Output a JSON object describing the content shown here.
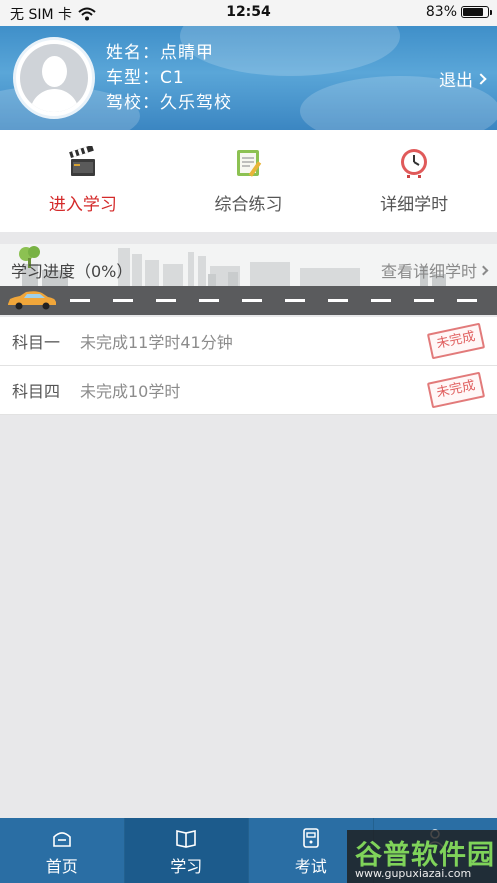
{
  "status_bar": {
    "carrier": "无 SIM 卡",
    "time": "12:54",
    "battery": "83%",
    "battery_level": 0.83
  },
  "header": {
    "name_label": "姓名：",
    "name_value": "点睛甲",
    "car_label": "车型：",
    "car_value": "C1",
    "school_label": "驾校：",
    "school_value": "久乐驾校",
    "logout": "退出"
  },
  "functions": [
    {
      "label": "进入学习",
      "icon": "clapperboard-icon",
      "active": true
    },
    {
      "label": "综合练习",
      "icon": "notepad-icon",
      "active": false
    },
    {
      "label": "详细学时",
      "icon": "clock-icon",
      "active": false
    }
  ],
  "progress": {
    "title": "学习进度（0%）",
    "value": 0,
    "more": "查看详细学时"
  },
  "subjects": [
    {
      "name": "科目一",
      "status": "未完成11学时41分钟",
      "stamp": "未完成"
    },
    {
      "name": "科目四",
      "status": "未完成10学时",
      "stamp": "未完成"
    }
  ],
  "bottom_nav": [
    {
      "label": "首页",
      "icon": "home-icon",
      "active": false
    },
    {
      "label": "学习",
      "icon": "book-icon",
      "active": true
    },
    {
      "label": "考试",
      "icon": "exam-icon",
      "active": false
    },
    {
      "label": "",
      "icon": "profile-icon",
      "active": false
    }
  ],
  "watermark": {
    "title": "谷普软件园",
    "url": "www.gupuxiazai.com"
  }
}
